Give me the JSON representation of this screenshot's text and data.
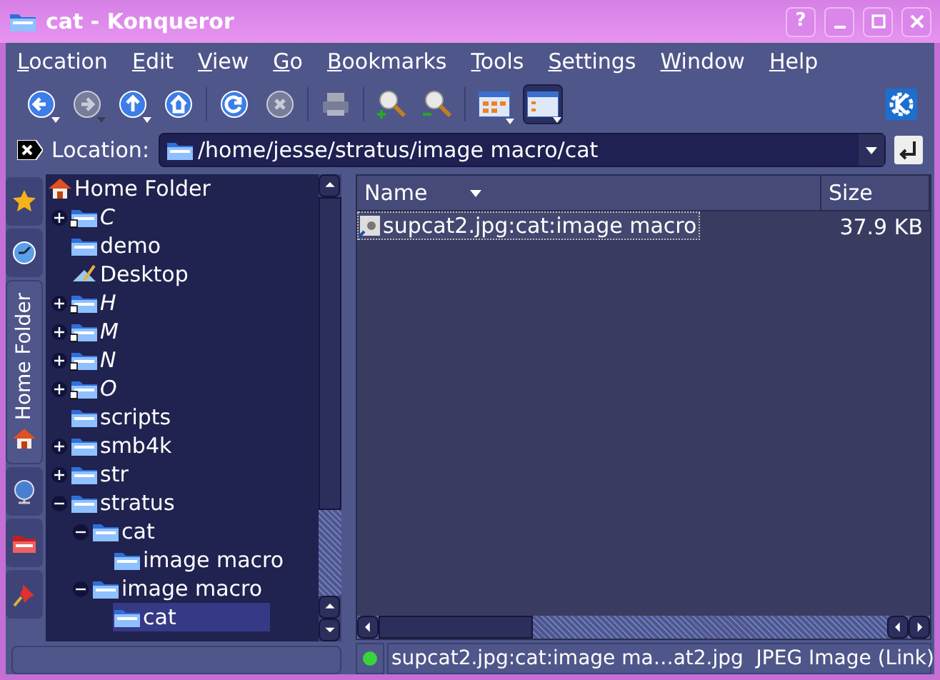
{
  "window": {
    "title": "cat - Konqueror",
    "buttons": [
      {
        "kind": "help",
        "label": "?"
      },
      {
        "kind": "minimize"
      },
      {
        "kind": "maximize"
      },
      {
        "kind": "close"
      }
    ]
  },
  "menu": [
    "Location",
    "Edit",
    "View",
    "Go",
    "Bookmarks",
    "Tools",
    "Settings",
    "Window",
    "Help"
  ],
  "toolbar": [
    {
      "kind": "back",
      "disabled": false,
      "dropdown": true
    },
    {
      "kind": "forward",
      "disabled": true,
      "dropdown": true
    },
    {
      "kind": "up",
      "disabled": false,
      "dropdown": true
    },
    {
      "kind": "home",
      "disabled": false,
      "dropdown": false
    },
    {
      "kind": "sep"
    },
    {
      "kind": "reload",
      "disabled": false,
      "dropdown": false
    },
    {
      "kind": "stop",
      "disabled": true,
      "dropdown": false
    },
    {
      "kind": "sep"
    },
    {
      "kind": "print",
      "disabled": true,
      "dropdown": false
    },
    {
      "kind": "sep"
    },
    {
      "kind": "zoom-in",
      "disabled": false,
      "dropdown": false
    },
    {
      "kind": "zoom-out",
      "disabled": false,
      "dropdown": false
    },
    {
      "kind": "sep"
    }
  ],
  "view_modes": [
    {
      "kind": "icons",
      "selected": false
    },
    {
      "kind": "details",
      "selected": true
    }
  ],
  "location": {
    "label": "Location:",
    "value": "/home/jesse/stratus/image macro/cat"
  },
  "side_tabs": [
    {
      "kind": "bookmarks",
      "selected": false
    },
    {
      "kind": "history",
      "selected": false
    },
    {
      "kind": "home",
      "label": "Home Folder",
      "selected": true
    },
    {
      "kind": "network",
      "selected": false
    },
    {
      "kind": "services",
      "selected": false
    },
    {
      "kind": "pin",
      "selected": false
    }
  ],
  "tree": {
    "root": "Home Folder",
    "items": [
      {
        "name": "C",
        "kind": "link",
        "expanded": false
      },
      {
        "name": "demo",
        "kind": "folder"
      },
      {
        "name": "Desktop",
        "kind": "desktop"
      },
      {
        "name": "H",
        "kind": "link",
        "expanded": false
      },
      {
        "name": "M",
        "kind": "link",
        "expanded": false
      },
      {
        "name": "N",
        "kind": "link",
        "expanded": false
      },
      {
        "name": "O",
        "kind": "link",
        "expanded": false
      },
      {
        "name": "scripts",
        "kind": "folder"
      },
      {
        "name": "smb4k",
        "kind": "folder",
        "expanded": false
      },
      {
        "name": "str",
        "kind": "folder",
        "expanded": false
      },
      {
        "name": "stratus",
        "kind": "folder",
        "expanded": true,
        "children": [
          {
            "name": "cat",
            "kind": "folder",
            "expanded": true,
            "children": [
              {
                "name": "image macro",
                "kind": "folder",
                "selected": false
              }
            ]
          },
          {
            "name": "image macro",
            "kind": "folder",
            "expanded": true,
            "children": [
              {
                "name": "cat",
                "kind": "folder",
                "selected": true
              }
            ]
          }
        ]
      }
    ]
  },
  "files": {
    "columns": [
      "Name",
      "Size"
    ],
    "rows": [
      {
        "name": "supcat2.jpg:cat:image macro",
        "size": "37.9 KB",
        "selected": true
      }
    ]
  },
  "status_bar": {
    "text": "supcat2.jpg:cat:image ma…at2.jpg  JPEG Image (Link)"
  }
}
